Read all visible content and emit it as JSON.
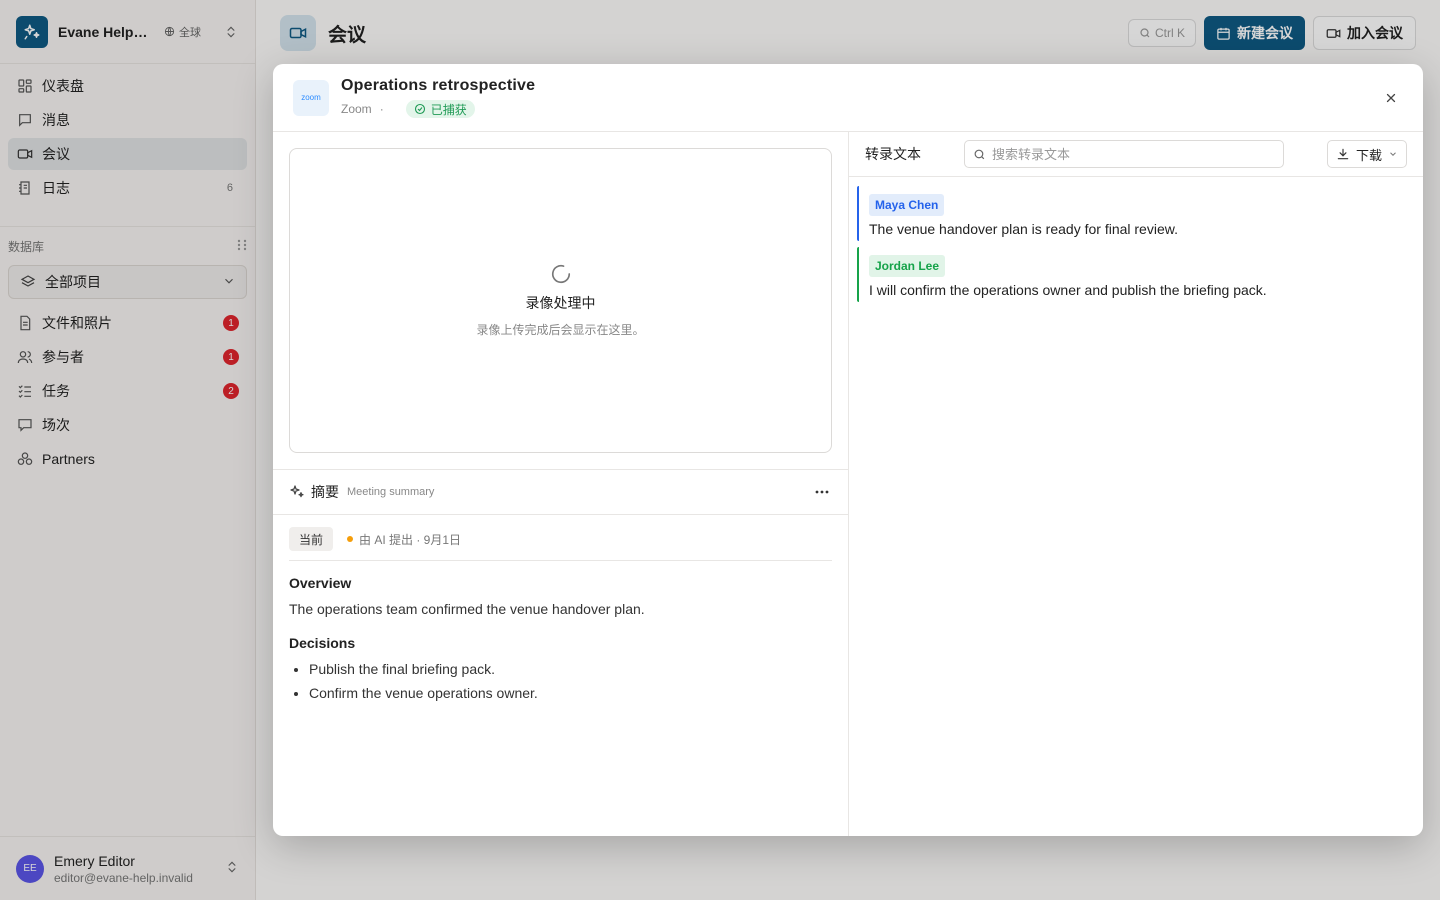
{
  "workspace": {
    "name": "Evane Help Center",
    "scope": "全球"
  },
  "nav": [
    {
      "label": "仪表盘",
      "icon": "dashboard-icon"
    },
    {
      "label": "消息",
      "icon": "message-icon"
    },
    {
      "label": "会议",
      "icon": "video-icon",
      "active": true
    },
    {
      "label": "日志",
      "icon": "log-icon",
      "count": "6"
    }
  ],
  "database": {
    "section_label": "数据库",
    "scope_select": "全部项目",
    "items": [
      {
        "label": "文件和照片",
        "icon": "file-icon",
        "badge": "1"
      },
      {
        "label": "参与者",
        "icon": "users-icon",
        "badge": "1"
      },
      {
        "label": "任务",
        "icon": "tasks-icon",
        "badge": "2"
      },
      {
        "label": "场次",
        "icon": "session-icon"
      },
      {
        "label": "Partners",
        "icon": "partners-icon"
      }
    ]
  },
  "user": {
    "initials": "EE",
    "name": "Emery Editor",
    "email": "editor@evane-help.invalid"
  },
  "page": {
    "title": "会议",
    "shortcut": "Ctrl K",
    "new_meeting": "新建会议",
    "join_meeting": "加入会议"
  },
  "modal": {
    "title": "Operations retrospective",
    "provider": "Zoom",
    "provider_logo": "zoom",
    "separator": "·",
    "status": "已捕获",
    "video": {
      "title": "录像处理中",
      "subtitle": "录像上传完成后会显示在这里。"
    },
    "summary": {
      "title": "摘要",
      "subtitle": "Meeting summary",
      "version_tag": "当前",
      "version_meta": "由 AI 提出 · 9月1日",
      "overview_heading": "Overview",
      "overview_text": "The operations team confirmed the venue handover plan.",
      "decisions_heading": "Decisions",
      "decisions": [
        "Publish the final briefing pack.",
        "Confirm the venue operations owner."
      ]
    },
    "transcript": {
      "title": "转录文本",
      "search_placeholder": "搜索转录文本",
      "download": "下载",
      "segments": [
        {
          "speaker": "Maya Chen",
          "text": "The venue handover plan is ready for final review.",
          "color": "blue"
        },
        {
          "speaker": "Jordan Lee",
          "text": "I will confirm the operations owner and publish the briefing pack.",
          "color": "green"
        }
      ]
    }
  },
  "colors": {
    "brand": "#0f5a84",
    "badge": "#e0262e",
    "status_green": "#1f9a55"
  }
}
